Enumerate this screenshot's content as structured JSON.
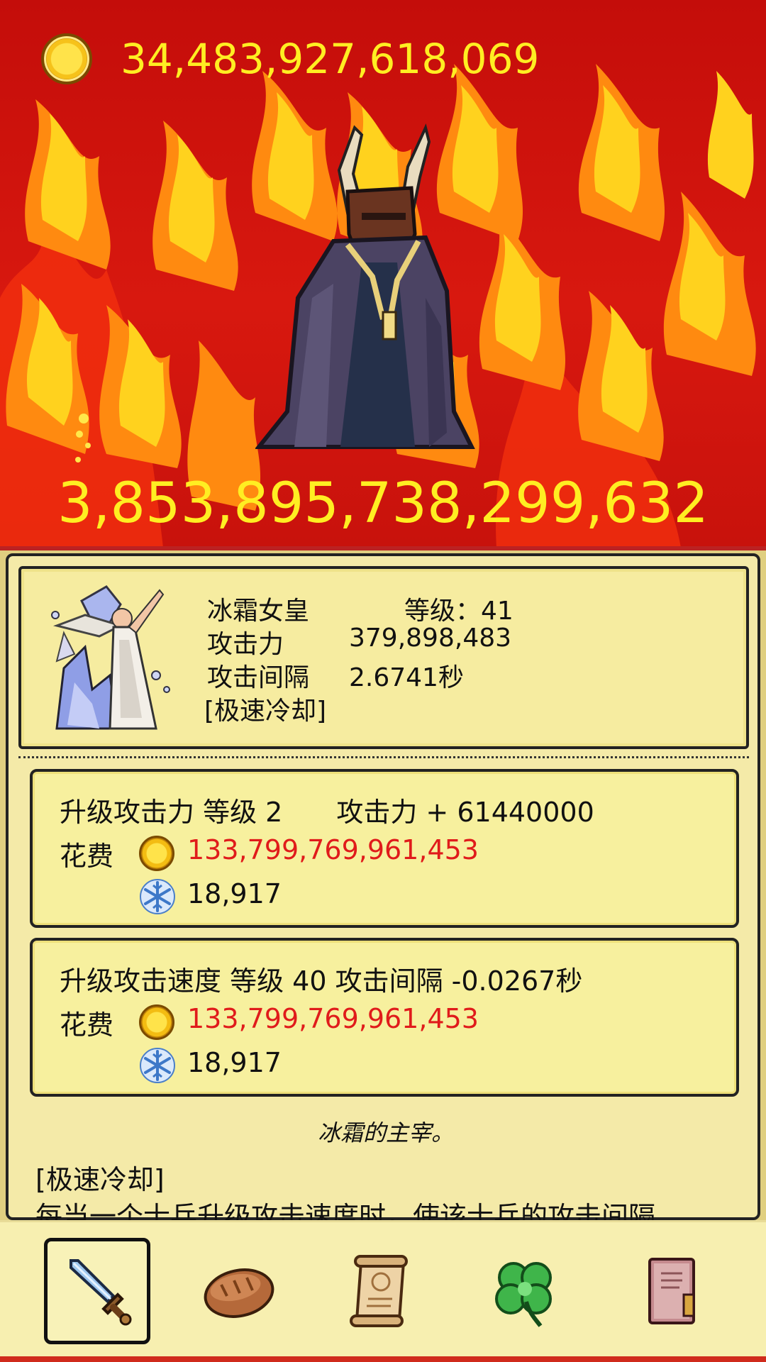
{
  "hud": {
    "gold_amount": "34,483,927,618,069",
    "boss_hp": "3,853,895,738,299,632"
  },
  "hero": {
    "name": "冰霜女皇",
    "level": "等级：41",
    "attack_label": "攻击力",
    "attack_value": "379,898,483",
    "interval_label": "攻击间隔",
    "interval_value": "2.6741秒",
    "skill": "[极速冷却]"
  },
  "upgrades": [
    {
      "title": "升级攻击力 等级 2　　攻击力 + 61440000",
      "cost_label": "花费",
      "gold_cost": "133,799,769,961,453",
      "ice_cost": "18,917"
    },
    {
      "title": "升级攻击速度 等级 40 攻击间隔 -0.0267秒",
      "cost_label": "花费",
      "gold_cost": "133,799,769,961,453",
      "ice_cost": "18,917"
    }
  ],
  "description": {
    "flavor": "冰霜的主宰。",
    "skill_title": "[极速冷却]",
    "skill_text": "每当一个士兵升级攻击速度时，使该士兵的攻击间隔"
  },
  "nav": [
    {
      "icon": "sword-icon",
      "active": true
    },
    {
      "icon": "bread-icon",
      "active": false
    },
    {
      "icon": "scroll-icon",
      "active": false
    },
    {
      "icon": "clover-icon",
      "active": false
    },
    {
      "icon": "book-icon",
      "active": false
    }
  ],
  "colors": {
    "gold_text": "#ffee22",
    "cost_red": "#e01b1b",
    "panel": "#f4eaa8",
    "fire_bg": "#c40d0a"
  }
}
